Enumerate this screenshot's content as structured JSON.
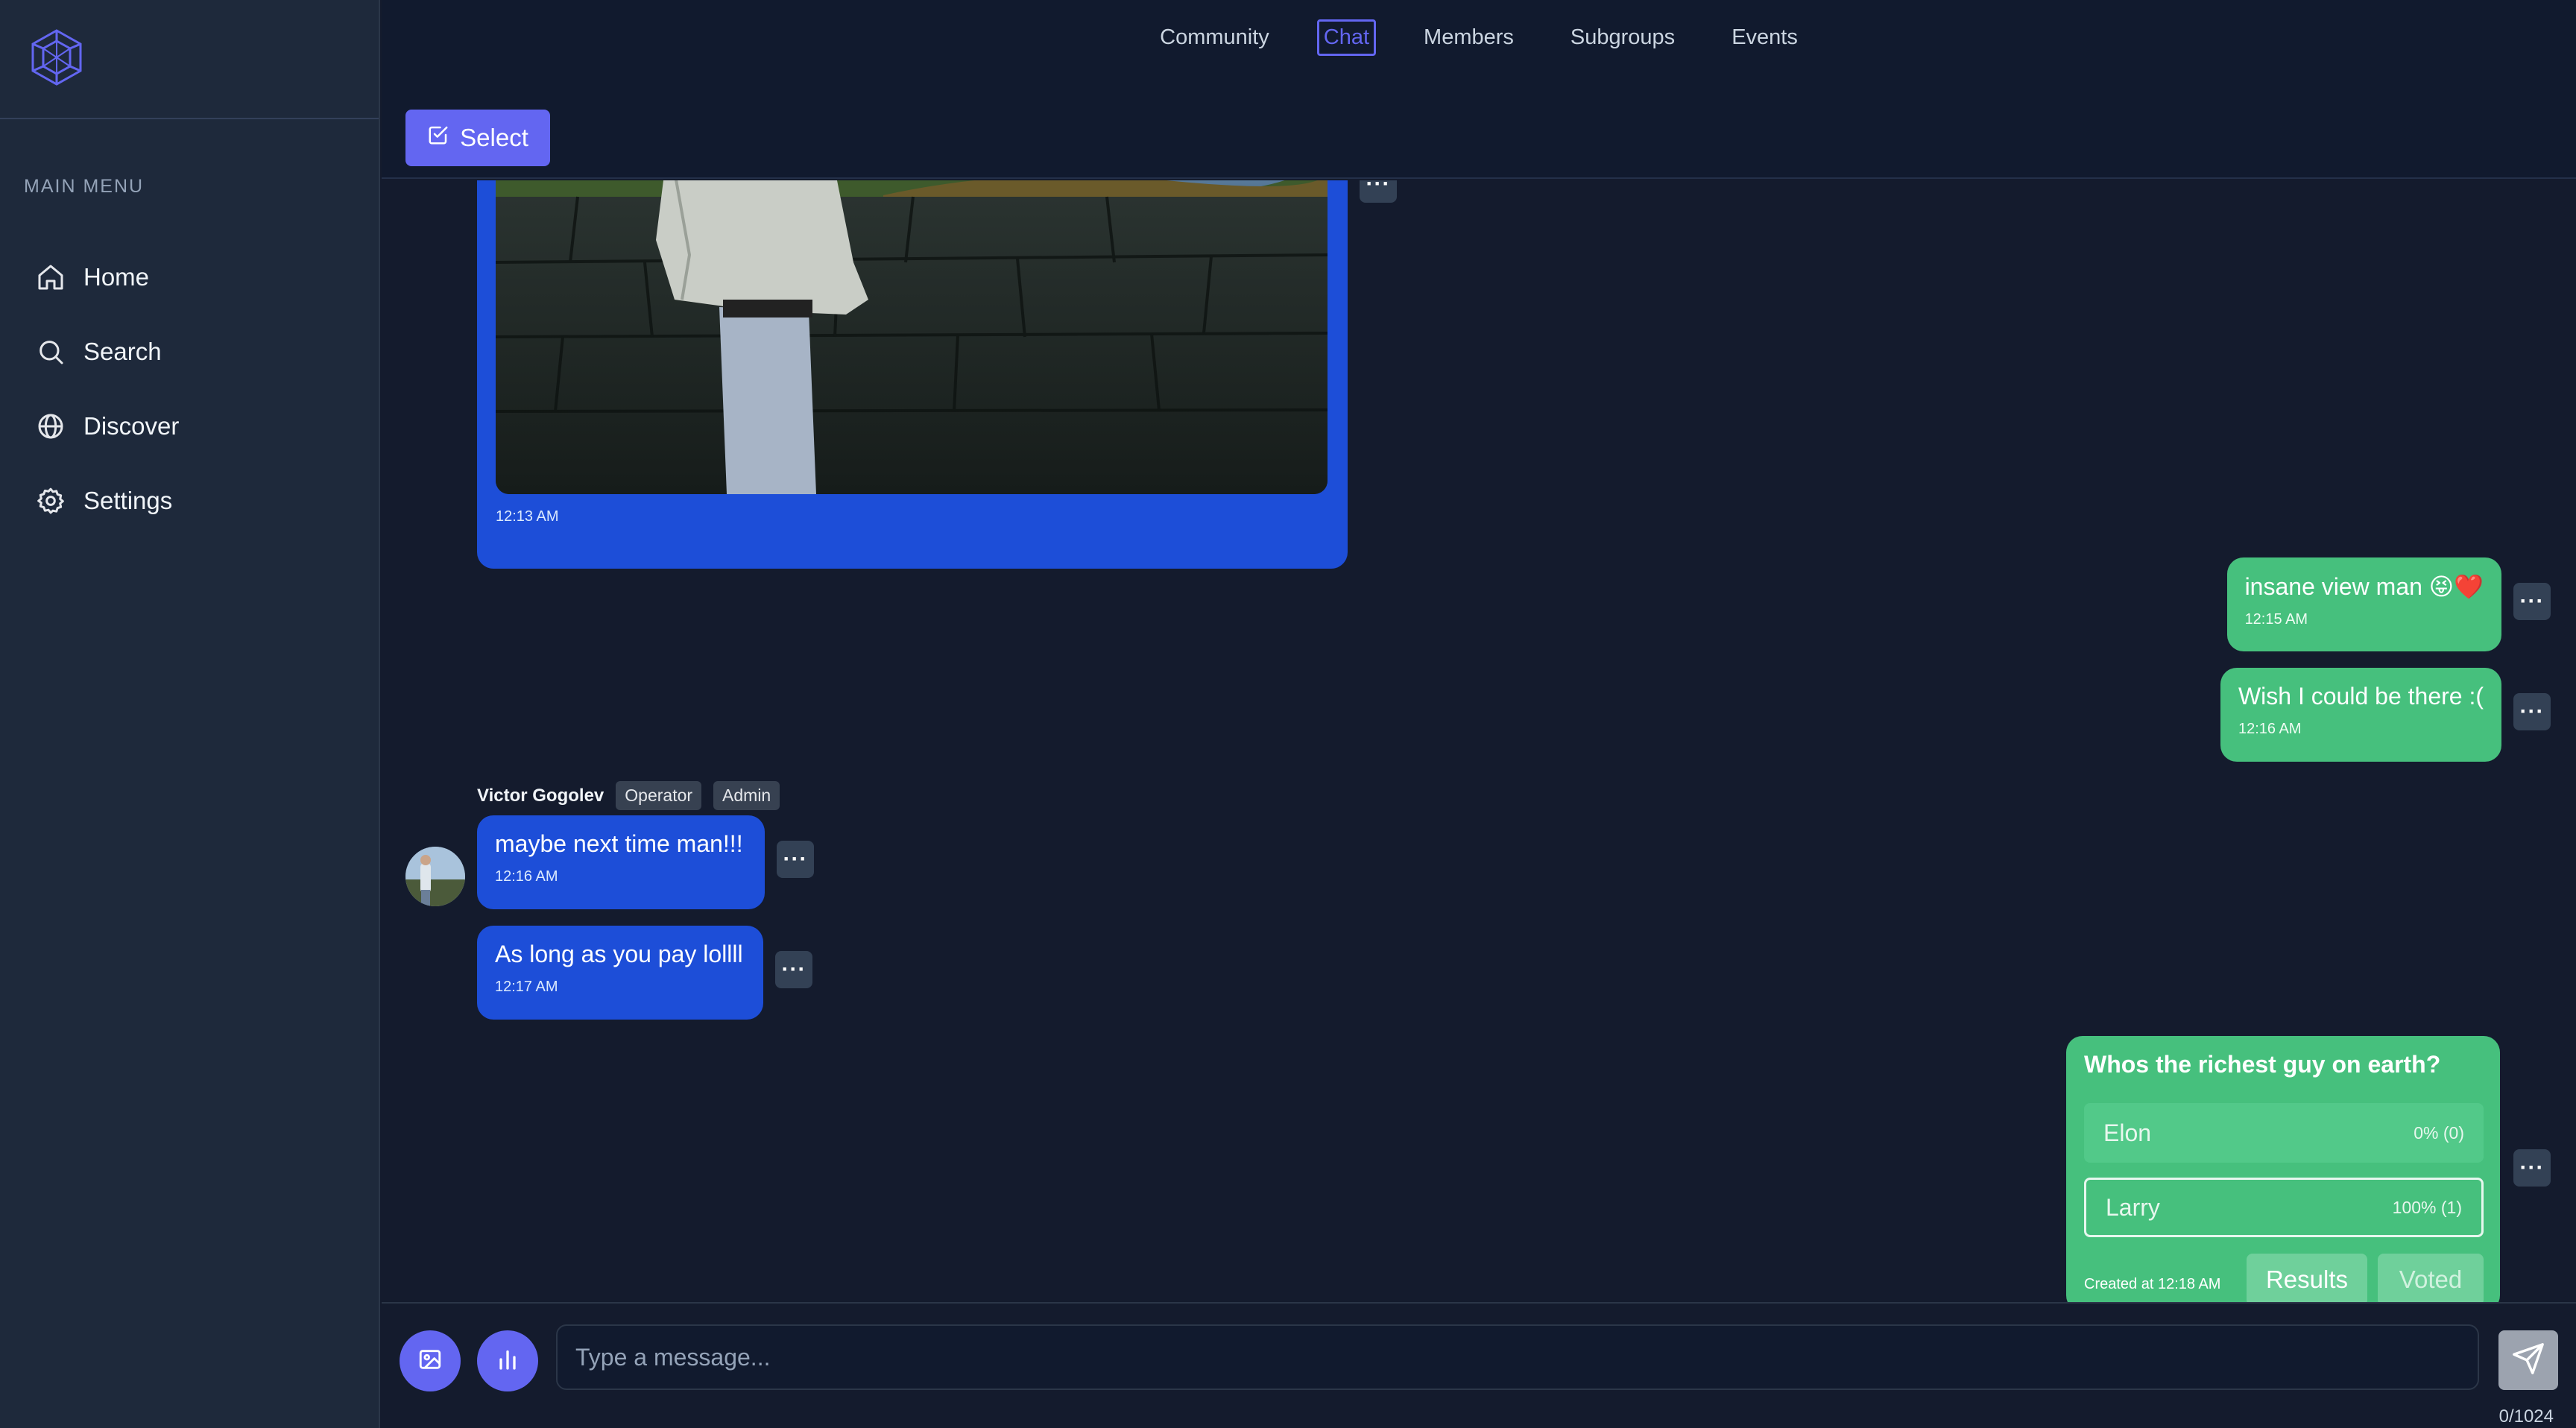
{
  "sidebar": {
    "logo_icon": "hexagon-network-icon",
    "menu_title": "MAIN MENU",
    "items": [
      {
        "label": "Home",
        "icon": "home-icon"
      },
      {
        "label": "Search",
        "icon": "search-icon"
      },
      {
        "label": "Discover",
        "icon": "globe-icon"
      },
      {
        "label": "Settings",
        "icon": "gear-icon"
      }
    ]
  },
  "topnav": {
    "tabs": [
      {
        "label": "Community"
      },
      {
        "label": "Chat",
        "active": true
      },
      {
        "label": "Members"
      },
      {
        "label": "Subgroups"
      },
      {
        "label": "Events"
      }
    ],
    "select_label": "Select"
  },
  "chat": {
    "image_message": {
      "time": "12:13 AM"
    },
    "outgoing": [
      {
        "text": "insane view man 😝❤️",
        "time": "12:15 AM"
      },
      {
        "text": "Wish I could be there :(",
        "time": "12:16 AM"
      }
    ],
    "sender": {
      "name": "Victor Gogolev",
      "badges": [
        "Operator",
        "Admin"
      ]
    },
    "incoming": [
      {
        "text": "maybe next time man!!!",
        "time": "12:16 AM"
      },
      {
        "text": "As long as you pay lollll",
        "time": "12:17 AM"
      }
    ],
    "more_label": "···",
    "poll": {
      "question": "Whos the richest guy on earth?",
      "options": [
        {
          "label": "Elon",
          "result": "0% (0)",
          "percent": 0,
          "votes": 0
        },
        {
          "label": "Larry",
          "result": "100% (1)",
          "percent": 100,
          "votes": 1
        }
      ],
      "created": "Created at 12:18 AM",
      "results_label": "Results",
      "voted_label": "Voted"
    }
  },
  "composer": {
    "placeholder": "Type a message...",
    "counter": "0/1024",
    "image_icon": "image-icon",
    "poll_icon": "bar-chart-icon",
    "send_icon": "send-icon"
  },
  "colors": {
    "accent": "#6366f1",
    "incoming_bubble": "#1d4ed8",
    "outgoing_bubble": "#46c07d",
    "sidebar_bg": "#1e293b",
    "page_bg": "#141b2d"
  }
}
